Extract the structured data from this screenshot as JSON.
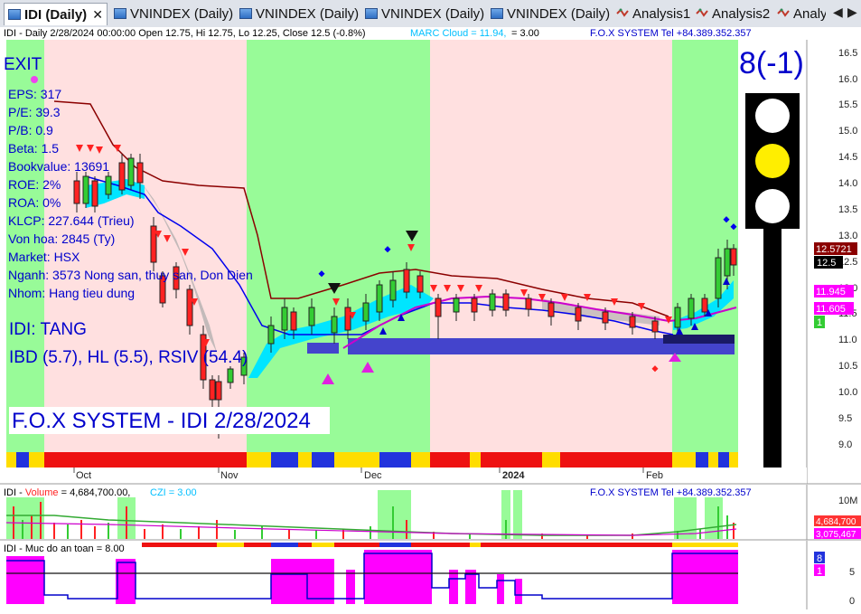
{
  "tabs": [
    {
      "label": "IDI (Daily)",
      "active": true
    },
    {
      "label": "VNINDEX (Daily)"
    },
    {
      "label": "VNINDEX (Daily)"
    },
    {
      "label": "VNINDEX (Daily)"
    },
    {
      "label": "VNINDEX (Daily)"
    },
    {
      "label": "Analysis1"
    },
    {
      "label": "Analysis2"
    },
    {
      "label": "Analy"
    }
  ],
  "tab_close": "✕",
  "nav_left": "◀",
  "nav_right": "▶",
  "price_panel": {
    "header": "IDI - Daily 2/28/2024 00:00:00 Open 12.75, Hi 12.75, Lo 12.25, Close 12.5 (-0.8%)",
    "marc": "MARC Cloud = 11.94,",
    "marc_val": "= 3.00",
    "brand": "F.O.X SYSTEM Tel +84.389.352.357",
    "exit": "EXIT",
    "fundamentals": [
      "EPS: 317",
      "P/E: 39.3",
      "P/B: 0.9",
      "Beta: 1.5",
      "Bookvalue: 13691",
      "ROE: 2%",
      "ROA: 0%",
      "KLCP: 227.644 (Trieu)",
      "Von hoa: 2845 (Ty)",
      "Market: HSX",
      "Nganh: 3573 Nong san, thuy san, Don Dien",
      "Nhom: Hang tieu dung"
    ],
    "trend": "IDI: TANG",
    "scores": "IBD (5.7), HL (5.5), RSIV (54.4)",
    "watermark": "F.O.X SYSTEM - IDI 2/28/2024",
    "signal": "8(-1)",
    "y_ticks": [
      "16.5",
      "16.0",
      "15.5",
      "15.0",
      "14.5",
      "14.0",
      "13.5",
      "13.0",
      "12.5",
      "12.0",
      "11.5",
      "11.0",
      "10.5",
      "10.0",
      "9.5",
      "9.0"
    ],
    "x_labels": [
      "Oct",
      "Nov",
      "Dec",
      "2024",
      "Feb"
    ],
    "price_tags": [
      {
        "text": "12.5721",
        "color": "#8b0000"
      },
      {
        "text": "12.5",
        "color": "#000000"
      },
      {
        "text": "11.945",
        "color": "#ff00ff"
      },
      {
        "text": "11.605",
        "color": "#ff00ff"
      },
      {
        "text": "1",
        "color": "#33cc33"
      }
    ]
  },
  "volume_panel": {
    "header_name": "IDI - ",
    "header_label": "Volume",
    "header_value": " = 4,684,700.00,",
    "czi": "CZI = 3.00",
    "brand": "F.O.X SYSTEM Tel +84.389.352.357",
    "y_label": "10M",
    "tags": [
      {
        "text": "4,684,700",
        "color": "#ff3333"
      },
      {
        "text": "3,075,467",
        "color": "#ff00ff"
      }
    ]
  },
  "safety_panel": {
    "header": "IDI - Muc do an toan = 8.00",
    "y_ticks": [
      "5",
      "0"
    ],
    "tags": [
      {
        "text": "8",
        "color": "#2233dd"
      },
      {
        "text": "1",
        "color": "#ff00ff"
      }
    ]
  },
  "colors": {
    "bull_zone": "#98fb98",
    "bear_zone": "#ffe0e0",
    "cloud": "#00e5ff",
    "fundamental_text": "#0000cc",
    "magenta": "#ff00ff"
  }
}
